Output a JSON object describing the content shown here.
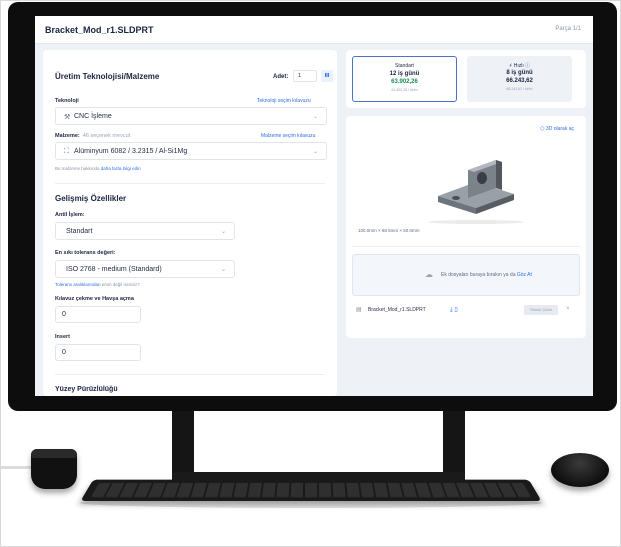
{
  "header": {
    "title": "Bracket_Mod_r1.SLDPRT",
    "part_count": "Parça 1/1"
  },
  "left": {
    "section_title": "Üretim Teknolojisi/Malzeme",
    "quantity_label": "Adet:",
    "quantity_value": "1",
    "quantity_button": "Ⅲ",
    "technology": {
      "label": "Teknoloji",
      "link": "Teknoloji seçim kılavuzu",
      "value": "CNC İşleme",
      "icon": "cnc-icon"
    },
    "material": {
      "label": "Malzeme:",
      "hint": "46 seçenek mevcut",
      "link": "Malzeme seçim kılavuzu",
      "value": "Alüminyum 6082 / 3.2315 / Al-Si1Mg",
      "icon": "material-icon"
    },
    "material_note_prefix": "Bu malzeme hakkında",
    "material_note_link": "daha fazla bilgi edin",
    "advanced_title": "Gelişmiş Özellikler",
    "anodizing": {
      "label": "Antil İşlem:",
      "value": "Standart"
    },
    "tolerance": {
      "label": "En sıkı tolerans değeri:",
      "value": "ISO 2768 - medium (Standard)"
    },
    "tolerance_note_link": "Tolerans aralıklarından",
    "tolerance_note_suffix": "emin değil misiniz?",
    "threads": {
      "label": "Kılavuz çekme ve Havşa açma",
      "value": "0"
    },
    "inserts": {
      "label": "Insert",
      "value": "0"
    },
    "surface_title": "Yüzey Pürüzlülüğü"
  },
  "right": {
    "standard": {
      "label": "Standart",
      "days": "12 iş günü",
      "price": "63.902,26",
      "sub": "61.902,26 / birim"
    },
    "fast": {
      "label": "Hızlı",
      "days": "8 iş günü",
      "price": "66.243,62",
      "sub": "66.243,62 / birim"
    },
    "viewer_link": "3D olarak aç",
    "dimensions": "100.0mm × 68.5mm × 50.0mm",
    "drop_prefix": "Ek dosyaları buraya bırakın ya da",
    "drop_link": "Göz At",
    "file": {
      "name": "Bracket_Mod_r1.SLDPRT",
      "tag": "Teknik Çizim"
    }
  },
  "colors": {
    "accent": "#2f6fe4",
    "price_green": "#1a8a5a",
    "bezel": "#0d0d0d",
    "screen_bg": "#eef1f6"
  }
}
